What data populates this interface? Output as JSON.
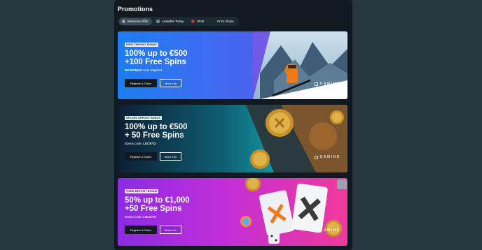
{
  "page": {
    "title": "Promotions"
  },
  "tabs": [
    {
      "label": "Welcome Offer",
      "icon": "star-icon",
      "active": true
    },
    {
      "label": "Available Today",
      "icon": "calendar-icon",
      "active": false
    },
    {
      "label": "Slots",
      "icon": "slots-icon",
      "active": false
    },
    {
      "label": "Prize Drops",
      "icon": "gift-icon",
      "active": false
    }
  ],
  "banners": [
    {
      "badge": "FIRST DEPOSIT BONUS",
      "heading_line1": "100% up to €500",
      "heading_line2": "+100 Free Spins",
      "sub_prefix": "NO BONUS",
      "sub_rest": " code required",
      "register_label": "Register & Claim",
      "info_label": "More Info",
      "brand": "GAMING"
    },
    {
      "badge": "SECOND DEPOSIT BONUS",
      "heading_line1": "100% up to €500",
      "heading_line2": "+ 50 Free Spins",
      "sub_prefix": "Bonus code: ",
      "sub_rest": "LUCKY2",
      "register_label": "Register & Claim",
      "info_label": "More Info",
      "brand": "GAMING"
    },
    {
      "badge": "THIRD DEPOSIT BONUS",
      "heading_line1": "50% up to €1,000",
      "heading_line2": "+50 Free Spins",
      "sub_prefix": "Bonus code: ",
      "sub_rest": "LUCKY3",
      "register_label": "Register & Claim",
      "info_label": "More Info",
      "brand": "GAMING"
    }
  ],
  "colors": {
    "page_bg": "#26373f",
    "panel_bg": "#111a21",
    "banner1": "#3e6cf2",
    "banner2": "#15a3a8",
    "banner3": "#c12ed9"
  }
}
